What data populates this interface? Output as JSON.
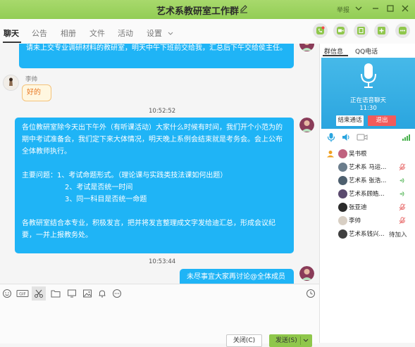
{
  "window": {
    "title": "艺术系教研室工作群",
    "report_label": "举报",
    "accent": "#92cd55"
  },
  "tabs": [
    "聊天",
    "公告",
    "相册",
    "文件",
    "活动",
    "设置"
  ],
  "toolbar_icons": [
    "voice-call-icon",
    "video-call-icon",
    "classroom-icon",
    "add-app-icon",
    "more-icon"
  ],
  "messages": {
    "m1_text": "请未上交专业调研材料的教研室，明天中午下班前交给我，汇总后下午交给侯主任。",
    "m2_sender": "李帅",
    "m2_sticker": "好的",
    "t1": "10:52:52",
    "m3_para1": "各位教研室除今天出下午外（有听课活动）大家什么时候有时间，我们开个小范为的期中考试准备会，我们定下来大体情况，明天晚上系例会结束就是考务会。会上公布全体教师执行。",
    "m3_issue_label": "主要问题：",
    "m3_issue1": "1、考试命题形式。（理论课与实践类技法课如何出题）",
    "m3_issue2": "2、考试是否统一时间",
    "m3_issue3": "3、同一科目是否统一命题",
    "m3_para3": "各教研室结合本专业，积极发言，把并将发言整理成文字发给迪汇总，形成会议纪要，一并上报教务处。",
    "t2": "10:53:44",
    "m4_text": "未尽事宜大家再讨论@全体成员"
  },
  "input": {
    "close_label": "关闭(C)",
    "send_label": "发送(S)"
  },
  "right_panel": {
    "tab1": "群信息",
    "tab2": "QQ电话",
    "voice_status": "正在语音聊天",
    "voice_time": "11:30",
    "end_call": "结束通话",
    "exit": "退出",
    "members": [
      {
        "name": "吴书根",
        "state": "host"
      },
      {
        "name": "艺术系 马运...",
        "state": "muted"
      },
      {
        "name": "艺术系 张浩...",
        "state": "speaking"
      },
      {
        "name": "艺术系顾皓...",
        "state": "speaking"
      },
      {
        "name": "张亚迪",
        "state": "muted"
      },
      {
        "name": "李帅",
        "state": "muted"
      },
      {
        "name": "艺术系钱兴...",
        "state": "待加入"
      }
    ]
  }
}
